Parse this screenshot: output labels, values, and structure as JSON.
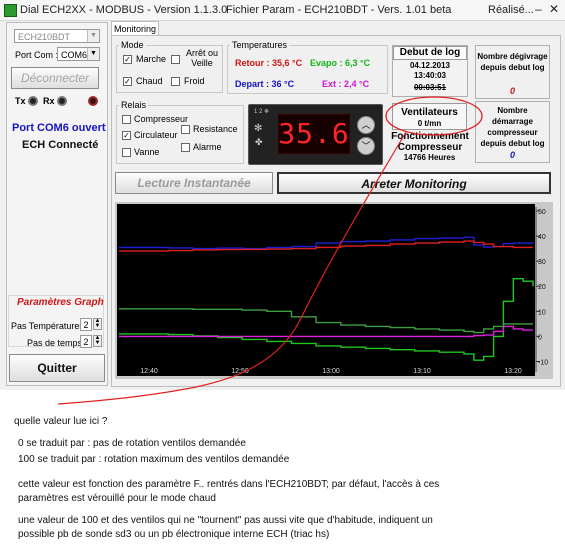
{
  "window": {
    "title_left": "Dial ECH2XX - MODBUS - Version 1.1.3.0",
    "title_middle": "Fichier Param - ECH210BDT - Vers. 1.01 beta",
    "title_right": "Réalisé..."
  },
  "sidebar": {
    "device_value": "ECH210BDT",
    "port_label": "Port Com :",
    "port_value": "COM6",
    "disconnect_label": "Déconnecter",
    "tx_label": "Tx",
    "rx_label": "Rx",
    "port_status": "Port COM6 ouvert",
    "device_status": "ECH Connecté",
    "graph_params_title": "Paramètres Graph",
    "temp_step_label": "Pas Températures",
    "temp_step_value": "2",
    "time_step_label": "Pas de temps",
    "time_step_value": "2",
    "quit_label": "Quitter"
  },
  "tabs": {
    "monitoring": "Monitoring"
  },
  "mode": {
    "title": "Mode",
    "marche": "Marche",
    "arret_veille": "Arrêt ou Veille",
    "chaud": "Chaud",
    "froid": "Froid"
  },
  "temperatures": {
    "title": "Temperatures",
    "retour": "Retour : 35,6 °C",
    "evapo": "Evapo : 6,3 °C",
    "depart": "Depart : 36 °C",
    "ext": "Ext : 2,4 °C"
  },
  "debut_log": {
    "title": "Debut de log",
    "date": "04.12.2013",
    "time": "13:40:03",
    "elapsed": "00:03:51"
  },
  "stats": {
    "defrost_label": "Nombre dégivrage depuis debut log",
    "defrost_value": "0",
    "compressor_starts_label": "Nombre démarrage compresseur depuis debut log",
    "compressor_starts_value": "0"
  },
  "ventilateurs": {
    "title": "Ventilateurs",
    "value": "0 t/mn"
  },
  "fonctionnement": {
    "title": "Fonctionnement Compresseur",
    "value": "14766 Heures"
  },
  "relais": {
    "title": "Relais",
    "compresseur": "Compresseur",
    "circulateur": "Circulateur",
    "resistance": "Resistance",
    "vanne": "Vanne",
    "alarme": "Alarme"
  },
  "display": {
    "value": "35.6"
  },
  "actions": {
    "lecture": "Lecture Instantanée",
    "arreter": "Arreter Monitoring"
  },
  "chart_data": {
    "type": "line",
    "title": "",
    "x_ticks": [
      "12:40",
      "12:50",
      "13:00",
      "13:10",
      "13:20"
    ],
    "x": [
      0,
      25,
      50,
      75,
      100,
      125,
      150,
      175,
      200,
      225,
      250,
      275,
      300,
      325,
      350,
      360,
      370,
      380,
      390,
      400,
      410,
      420
    ],
    "ylim": [
      -15,
      52
    ],
    "y_ticks": [
      -10,
      0,
      10,
      20,
      30,
      40,
      50
    ],
    "grid": false,
    "series": [
      {
        "color": "#1f1fd8",
        "values": [
          35.5,
          35.5,
          35.3,
          35.0,
          35.2,
          35.0,
          35.4,
          35.8,
          37.2,
          37.8,
          38.0,
          38.5,
          39.0,
          39.2,
          39.5,
          36.5,
          35.6,
          35.8,
          37.0,
          37.2,
          37.2,
          37.0
        ]
      },
      {
        "color": "#e02020",
        "values": [
          34.0,
          34.0,
          34.2,
          34.5,
          34.6,
          34.7,
          34.8,
          35.0,
          35.5,
          36.0,
          36.3,
          36.8,
          37.2,
          37.6,
          38.0,
          37.5,
          36.8,
          35.8,
          35.8,
          35.5,
          35.5,
          35.5
        ]
      },
      {
        "color": "#1fc81f",
        "values": [
          1.0,
          1.0,
          0.7,
          0.2,
          -0.5,
          -1.2,
          -2.0,
          -2.8,
          -3.8,
          -4.3,
          -4.8,
          -5.3,
          -5.8,
          -6.3,
          -7.0,
          -9.5,
          -8.0,
          0.0,
          14.0,
          23.0,
          22.0,
          20.0
        ]
      },
      {
        "color": "#e020e0",
        "values": [
          0.0,
          0.0,
          0.0,
          0.0,
          0.0,
          0.0,
          0.0,
          0.0,
          0.0,
          0.0,
          0.0,
          0.0,
          0.0,
          0.0,
          0.0,
          0.3,
          0.5,
          2.0,
          4.0,
          3.0,
          2.5,
          2.5
        ]
      },
      {
        "color": "#3f9f3f",
        "values": [
          11.0,
          11.0,
          11.0,
          10.8,
          10.8,
          10.5,
          10.0,
          7.8,
          5.5,
          4.5,
          4.0,
          3.5,
          3.0,
          2.5,
          2.0,
          1.5,
          3.0,
          4.0,
          5.0,
          5.0,
          5.0,
          5.0
        ]
      }
    ]
  },
  "notes": {
    "question": "quelle valeur lue ici ?",
    "line1": "0 se traduit par : pas de rotation ventilos demandée",
    "line2": "100 se traduit par : rotation maximum des ventilos demandée",
    "line3": "cette valeur est fonction des paramètre F.. rentrés dans l'ECH210BDT; par défaut, l'accès à ces",
    "line4": "paramètres est vérouillé pour le mode chaud",
    "line5": "une valeur de 100 et des ventilos qui ne \"tournent\" pas aussi vite que d'habitude, indiquent un",
    "line6": "possible pb  de sonde sd3 ou un pb électronique interne ECH (triac hs)"
  },
  "colors": {
    "accent_blue": "#1414c8",
    "accent_red": "#d21414",
    "accent_green": "#14a014",
    "accent_magenta": "#d214d2",
    "annotation_red": "#e02020"
  }
}
